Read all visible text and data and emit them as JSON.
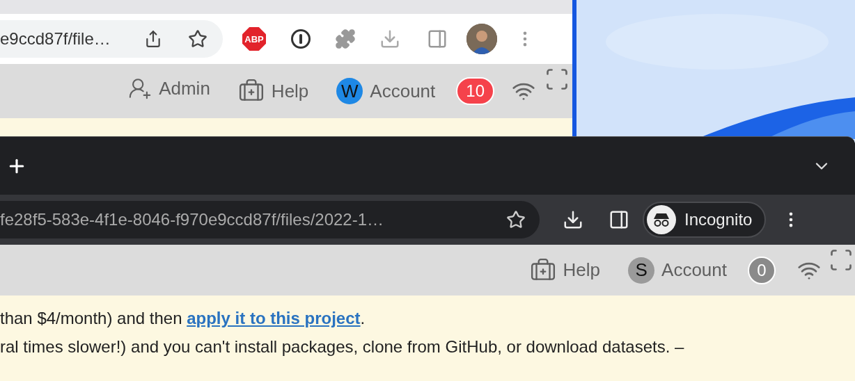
{
  "back_window": {
    "address": "e9ccd87f/file…",
    "adblock_badge": "ABP",
    "app_bar": {
      "items": [
        {
          "kind": "admin",
          "label": "Admin"
        },
        {
          "kind": "help",
          "label": "Help"
        },
        {
          "kind": "account",
          "avatar": "W",
          "color": "#1e88e5",
          "label": "Account"
        }
      ],
      "notifications": {
        "count": "10",
        "alert": true
      }
    }
  },
  "front_window": {
    "address": "fe28f5-583e-4f1e-8046-f970e9ccd87f/files/2022-1…",
    "profile": "Incognito",
    "app_bar": {
      "items": [
        {
          "kind": "help",
          "label": "Help"
        },
        {
          "kind": "account",
          "avatar": "S",
          "color": "#9a9a9a",
          "label": "Account"
        }
      ],
      "notifications": {
        "count": "0",
        "alert": false
      }
    },
    "notice": {
      "line_1": {
        "before": "than $4/month) and then ",
        "link": "apply it to this project",
        "after": "."
      },
      "line_2": "ral times slower!) and you can't install packages, clone from GitHub, or download datasets. –"
    }
  }
}
